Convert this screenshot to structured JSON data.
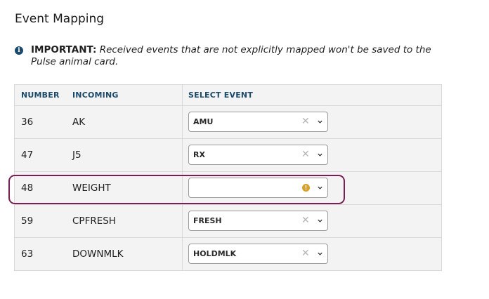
{
  "page": {
    "title": "Event Mapping"
  },
  "notice": {
    "icon": "info-icon",
    "label": "IMPORTANT:",
    "message": "Received events that are not explicitly mapped won't be saved to the Pulse animal card."
  },
  "table": {
    "columns": {
      "number": "NUMBER",
      "incoming": "INCOMING",
      "select_event": "SELECT EVENT"
    },
    "rows": [
      {
        "number": "36",
        "incoming": "AK",
        "event": "AMU",
        "state": "mapped"
      },
      {
        "number": "47",
        "incoming": "J5",
        "event": "RX",
        "state": "mapped"
      },
      {
        "number": "48",
        "incoming": "WEIGHT",
        "event": "",
        "state": "unmapped-warning"
      },
      {
        "number": "59",
        "incoming": "CPFRESH",
        "event": "FRESH",
        "state": "mapped"
      },
      {
        "number": "63",
        "incoming": "DOWNMLK",
        "event": "HOLDMLK",
        "state": "mapped"
      }
    ]
  },
  "colors": {
    "header_text": "#1b4a6b",
    "highlight_border": "#7a1f52",
    "warning": "#d8a12a",
    "table_bg": "#f3f3f3"
  }
}
